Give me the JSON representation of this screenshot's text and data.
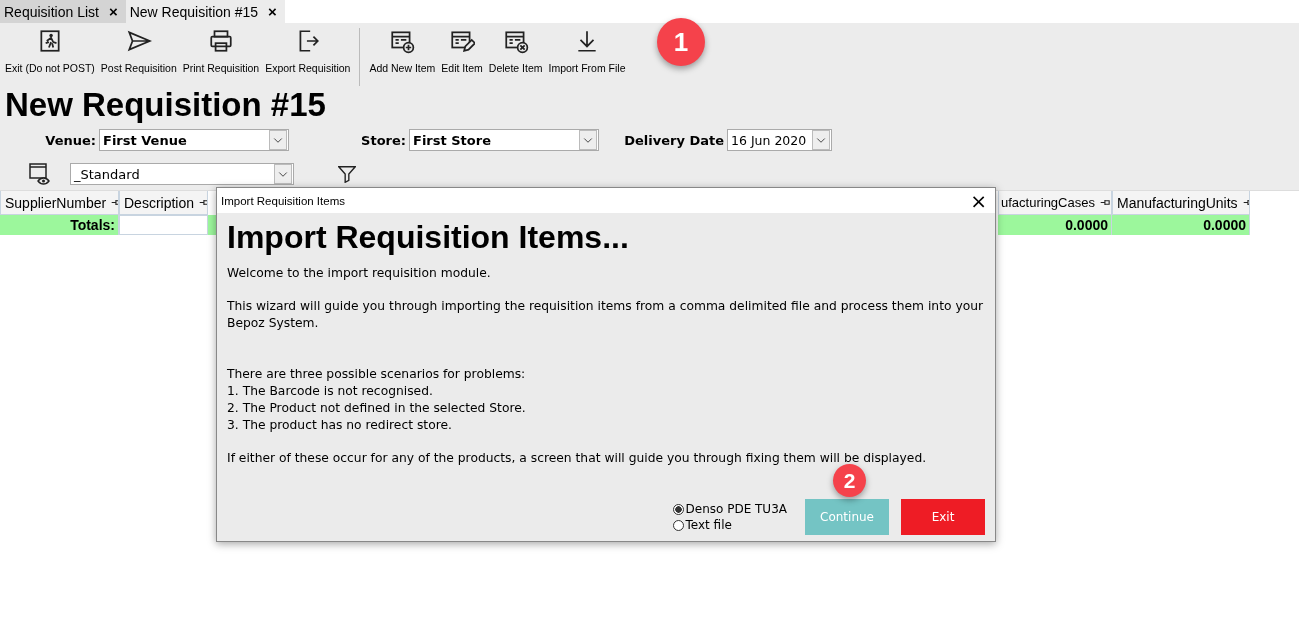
{
  "tabs": [
    {
      "label": "Requisition List",
      "selected": false,
      "close": "×"
    },
    {
      "label": "New Requisition #15",
      "selected": true,
      "close": "×"
    }
  ],
  "toolbar": [
    {
      "label": "Exit (Do not POST)",
      "kind": "button"
    },
    {
      "label": "Post Requisition",
      "kind": "button"
    },
    {
      "label": "Print Requisition",
      "kind": "button"
    },
    {
      "label": "Export Requisition",
      "kind": "button"
    },
    {
      "kind": "separator"
    },
    {
      "label": "Add New Item",
      "kind": "button"
    },
    {
      "label": "Edit Item",
      "kind": "button"
    },
    {
      "label": "Delete Item",
      "kind": "button"
    },
    {
      "label": "Import From File",
      "kind": "button"
    }
  ],
  "page_title": "New Requisition #15",
  "filters": {
    "venue": {
      "label": "Venue:",
      "value": "First Venue"
    },
    "store": {
      "label": "Store:",
      "value": "First Store"
    },
    "delivery_date": {
      "label": "Delivery Date",
      "value": "16 Jun 2020"
    },
    "layout": {
      "value": "_Standard"
    }
  },
  "table": {
    "columns": [
      {
        "label": "SupplierNumber"
      },
      {
        "label": "Description"
      },
      {
        "label": "ufacturingCases"
      },
      {
        "label": "ManufacturingUnits"
      }
    ],
    "totals": {
      "label": "Totals:",
      "values": [
        "0.0000",
        "0.0000"
      ]
    }
  },
  "dialog": {
    "title": "Import Requisition Items",
    "close": "×",
    "heading": "Import Requisition Items...",
    "paragraphs": [
      "Welcome to the import requisition module.",
      "This wizard will guide you through importing the requisition items from a comma delimited file and process them into your Bepoz System.",
      "There are three possible scenarios for problems:\n1. The Barcode is not recognised.\n2. The Product not defined in the selected Store.\n3. The product has no redirect store.",
      "If either of these occur for any of the products, a screen that will guide you through fixing them will be displayed."
    ],
    "options": [
      {
        "label": "Denso PDE TU3A",
        "selected": true
      },
      {
        "label": "Text file",
        "selected": false
      }
    ],
    "buttons": [
      {
        "label": "Continue",
        "kind": "primary"
      },
      {
        "label": "Exit",
        "kind": "danger"
      }
    ]
  },
  "badges": [
    {
      "label": "1"
    },
    {
      "label": "2"
    }
  ]
}
